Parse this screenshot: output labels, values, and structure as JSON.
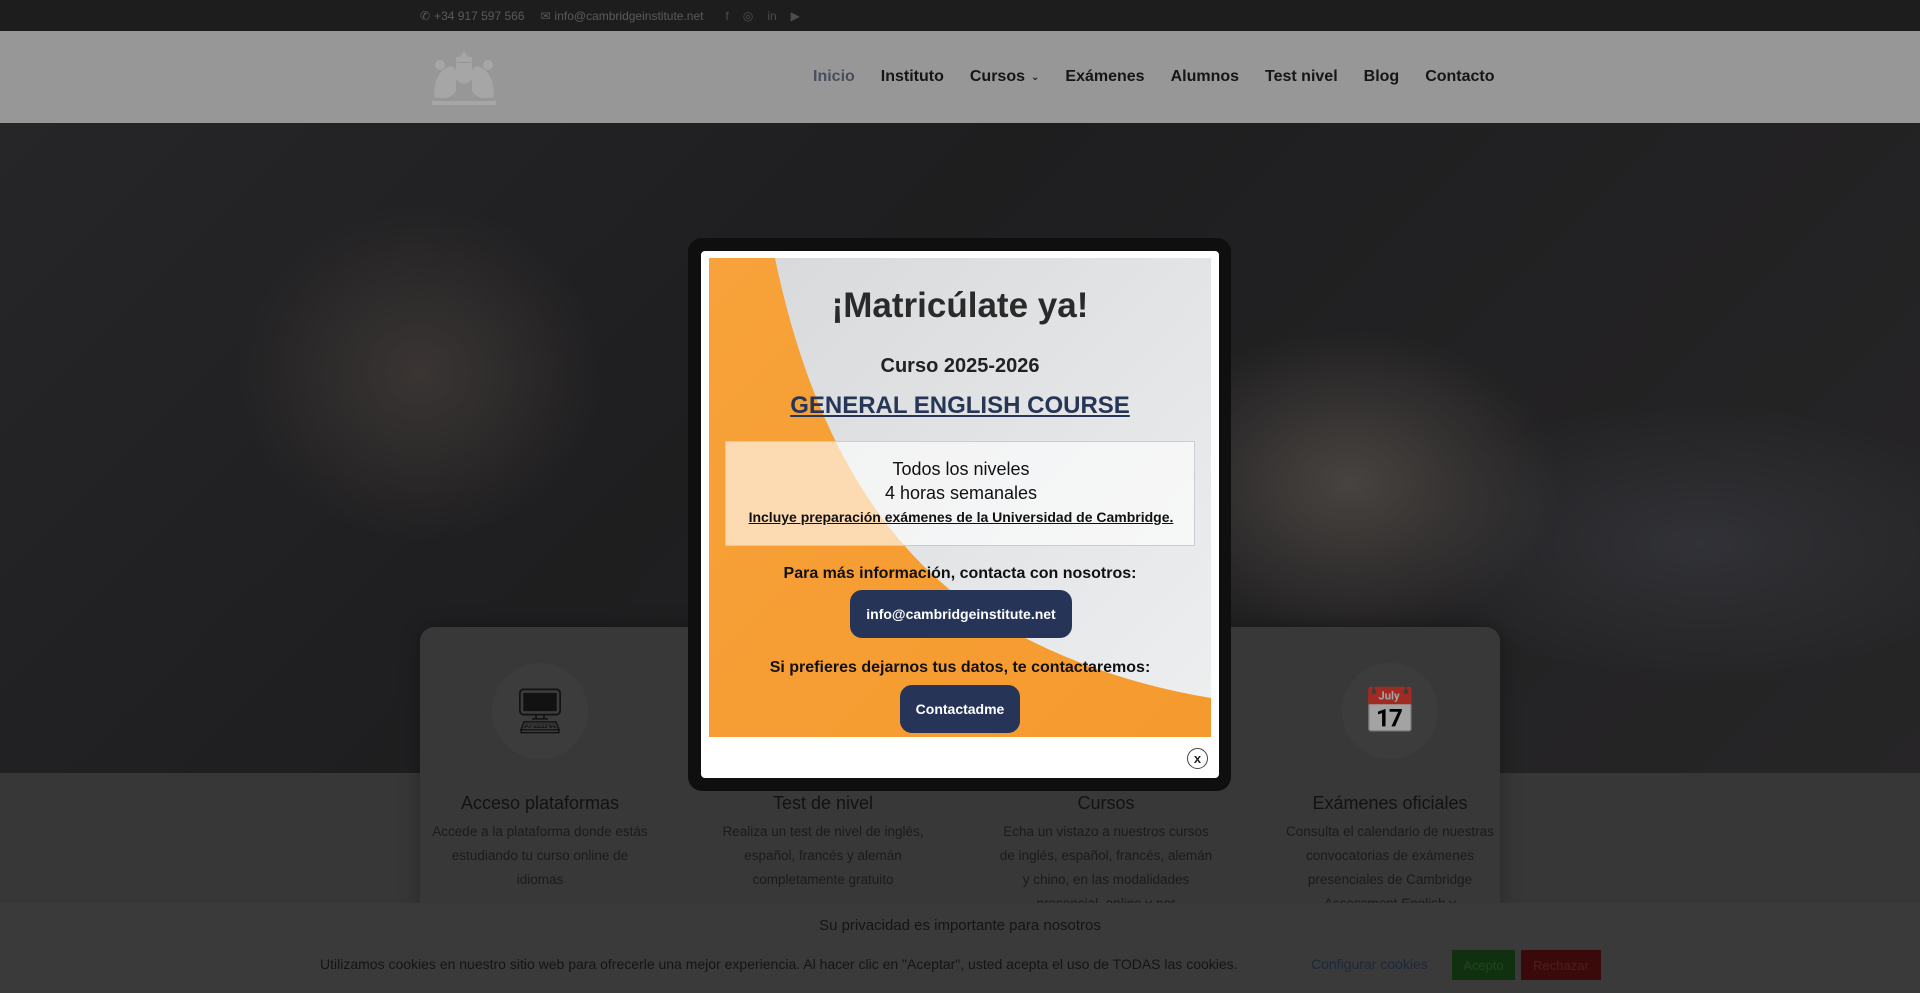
{
  "topbar": {
    "phone": "+34 917 597 566",
    "email": "info@cambridgeinstitute.net",
    "social": [
      "facebook-icon",
      "instagram-icon",
      "linkedin-icon",
      "youtube-icon"
    ]
  },
  "nav": {
    "items": [
      {
        "label": "Inicio",
        "active": true
      },
      {
        "label": "Instituto"
      },
      {
        "label": "Cursos",
        "dropdown": true
      },
      {
        "label": "Exámenes"
      },
      {
        "label": "Alumnos"
      },
      {
        "label": "Test nivel"
      },
      {
        "label": "Blog"
      },
      {
        "label": "Contacto"
      }
    ]
  },
  "cards": [
    {
      "icon": "monitor-icon",
      "title": "Acceso plataformas",
      "text": "Accede a la plataforma donde estás estudiando tu curso online de idiomas"
    },
    {
      "icon": "test-icon",
      "title": "Test de nivel",
      "text": "Realiza un test de nivel de inglés, español, francés y alemán completamente gratuito"
    },
    {
      "icon": "book-icon",
      "title": "Cursos",
      "text": "Echa un vistazo a nuestros cursos de inglés, español, francés, alemán y chino, en las modalidades presencial, online y por"
    },
    {
      "icon": "calendar-icon",
      "title": "Exámenes oficiales",
      "text": "Consulta el calendario de nuestras convocatorias de exámenes presenciales de Cambridge Assessment English y"
    }
  ],
  "modal": {
    "headline": "¡Matricúlate ya!",
    "year": "Curso 2025-2026",
    "course": "GENERAL ENGLISH COURSE",
    "box_line1": "Todos los niveles",
    "box_line2": "4 horas semanales",
    "box_line3": "Incluye preparación exámenes de la Universidad de Cambridge.",
    "info_text": "Para más información, contacta con nosotros:",
    "email_button": "info@cambridgeinstitute.net",
    "prefer_text": "Si prefieres dejarnos tus datos, te contactaremos:",
    "contact_button": "Contactadme",
    "close_label": "x"
  },
  "cookie": {
    "title": "Su privacidad es importante para nosotros",
    "text": "Utilizamos cookies en nuestro sitio web para ofrecerle una mejor experiencia. Al hacer clic en \"Aceptar\", usted acepta el uso de TODAS las cookies.",
    "configure": "Configurar cookies",
    "accept": "Acepto",
    "reject": "Rechazar"
  },
  "colors": {
    "navy": "#263557",
    "orange": "#f39a34",
    "nav_active": "#6d7a90"
  }
}
